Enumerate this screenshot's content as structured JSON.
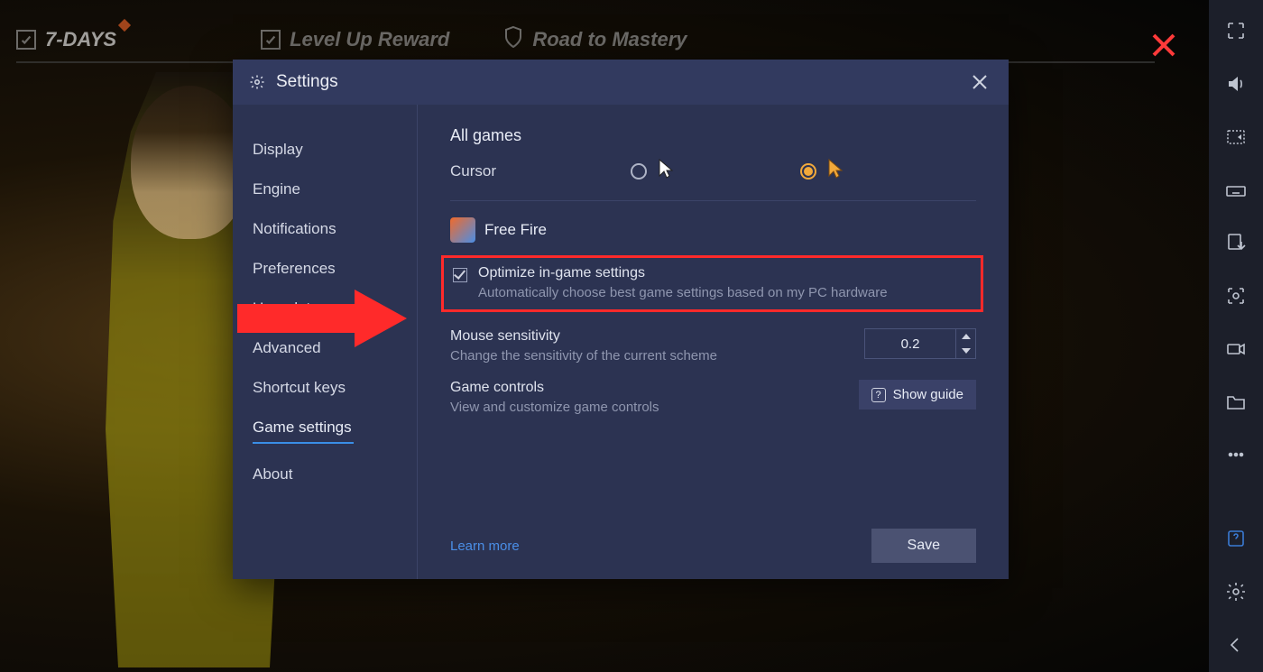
{
  "game_nav": {
    "tab1": "7-DAYS",
    "tab2": "Level Up Reward",
    "tab3": "Road to Mastery"
  },
  "modal": {
    "title": "Settings",
    "nav": {
      "display": "Display",
      "engine": "Engine",
      "notifications": "Notifications",
      "preferences": "Preferences",
      "userdata": "User data",
      "advanced": "Advanced",
      "shortcuts": "Shortcut keys",
      "gamesettings": "Game settings",
      "about": "About"
    },
    "content": {
      "all_games": "All games",
      "cursor_label": "Cursor",
      "game_name": "Free Fire",
      "optimize": {
        "title": "Optimize in-game settings",
        "desc": "Automatically choose best game settings based on my PC hardware"
      },
      "mouse": {
        "title": "Mouse sensitivity",
        "desc": "Change the sensitivity of the current scheme",
        "value": "0.2"
      },
      "controls": {
        "title": "Game controls",
        "desc": "View and customize game controls",
        "button": "Show guide"
      },
      "learn_more": "Learn more",
      "save": "Save"
    }
  }
}
